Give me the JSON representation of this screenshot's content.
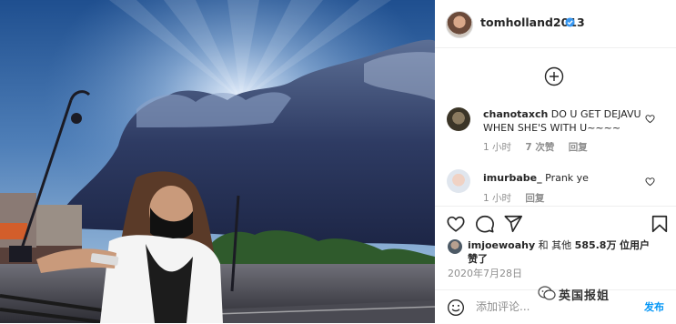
{
  "post": {
    "username": "tomholland2013",
    "verified": true,
    "date": "2020年7月28日",
    "likes": {
      "liker": "imjoewoahy",
      "connector": "和 其他",
      "count": "585.8万",
      "suffix": "位用户",
      "verb": "赞了"
    }
  },
  "comments": [
    {
      "user": "chanotaxch",
      "text": "DO U GET DEJAVU WHEN SHE'S WITH U~~~~",
      "time": "1 小时",
      "likes": "7 次赞",
      "reply": "回复"
    },
    {
      "user": "imurbabe_",
      "text": "Prank ye",
      "time": "1 小时",
      "reply": "回复"
    }
  ],
  "composer": {
    "placeholder": "添加评论...",
    "post_label": "发布"
  },
  "watermark": {
    "text": "英国报姐"
  },
  "icons": [
    "verified-badge-icon",
    "plus-circle-icon",
    "heart-icon",
    "comment-icon",
    "share-icon",
    "bookmark-icon",
    "smile-icon"
  ],
  "colors": {
    "accent": "#0095f6",
    "meta": "#8e8e8e",
    "text": "#262626",
    "border": "#efefef"
  }
}
